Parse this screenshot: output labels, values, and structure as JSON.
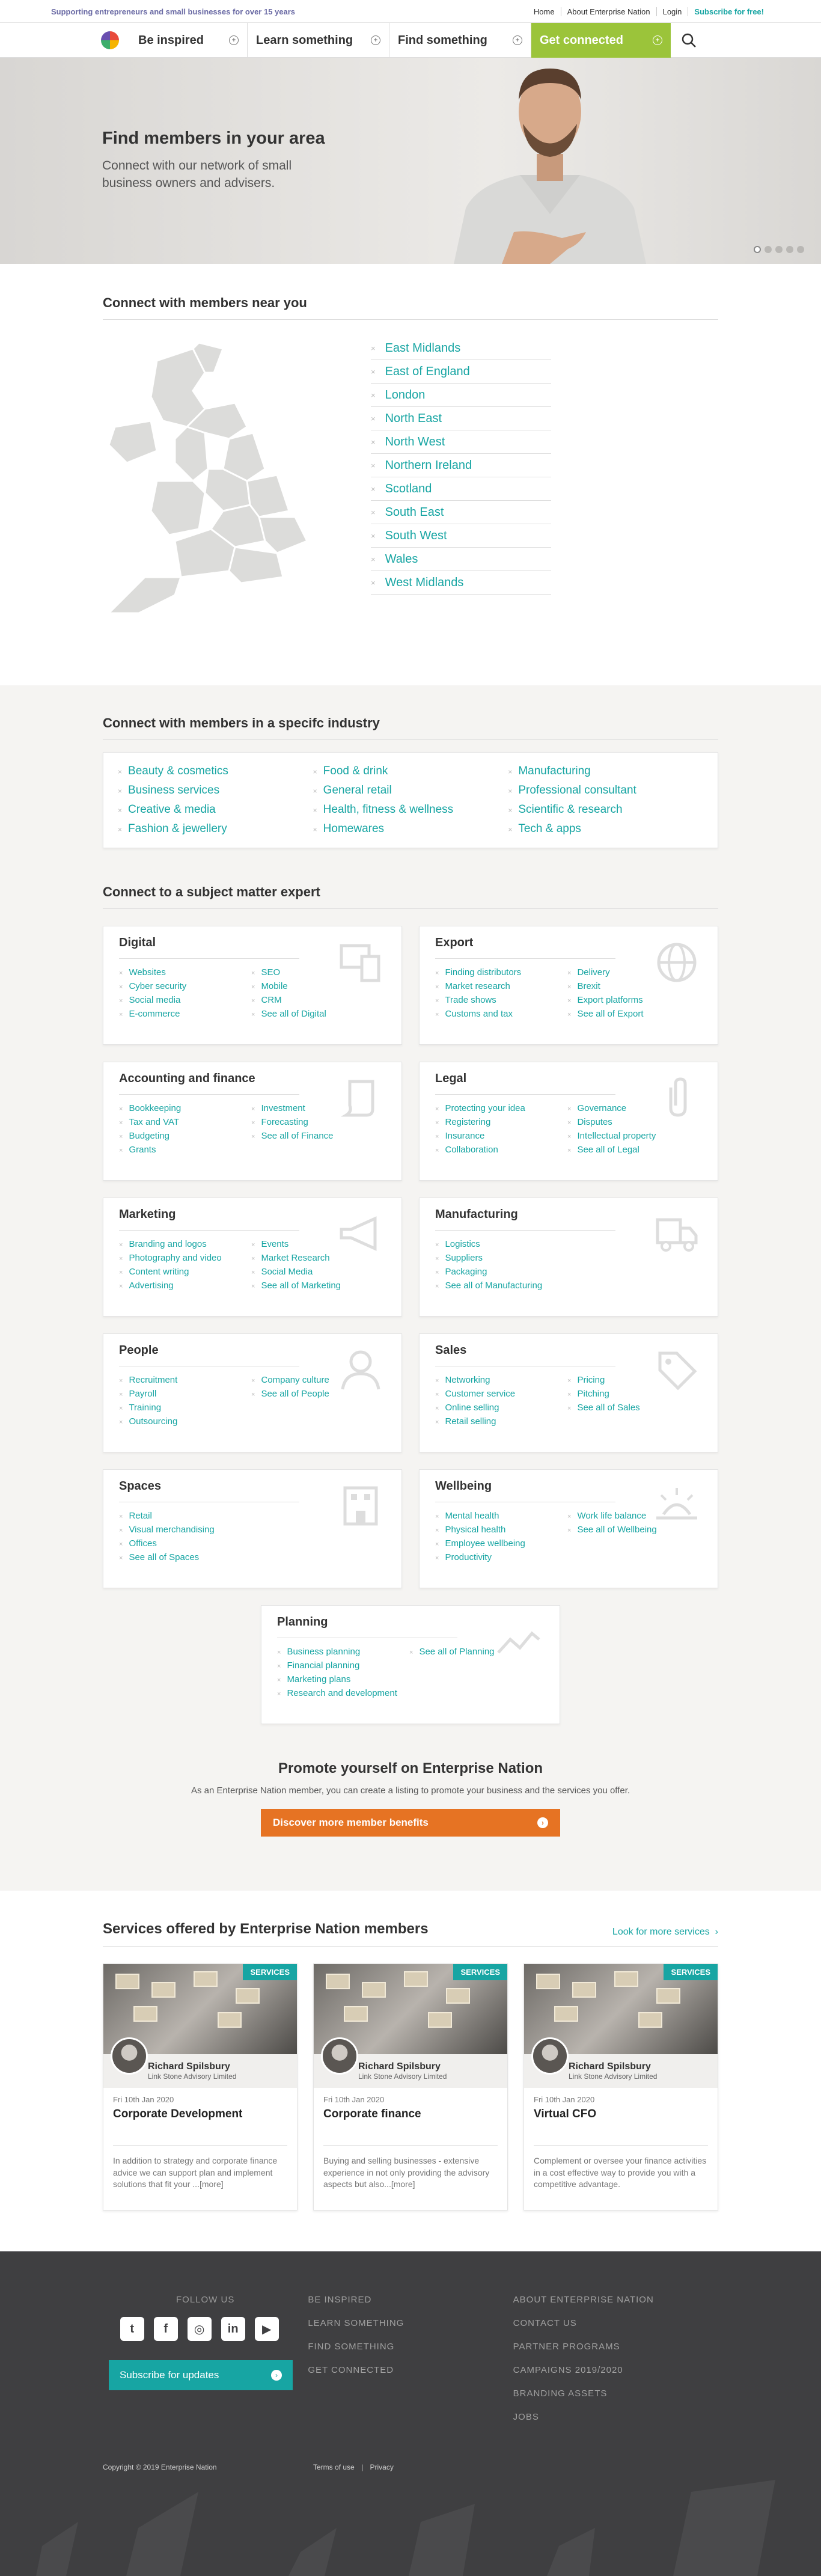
{
  "topbar": {
    "tagline": "Supporting entrepreneurs and small businesses for over 15 years",
    "links": [
      "Home",
      "About Enterprise Nation",
      "Login",
      "Subscribe for free!"
    ]
  },
  "nav": {
    "items": [
      "Be inspired",
      "Learn something",
      "Find something",
      "Get connected"
    ]
  },
  "hero": {
    "title": "Find members in your area",
    "subtitle": "Connect with our network of small business owners and advisers."
  },
  "regions": {
    "title": "Connect with members near you",
    "items": [
      "East Midlands",
      "East of England",
      "London",
      "North East",
      "North West",
      "Northern Ireland",
      "Scotland",
      "South East",
      "South West",
      "Wales",
      "West Midlands"
    ]
  },
  "industry": {
    "title": "Connect with members in a specifc industry",
    "items": [
      "Beauty & cosmetics",
      "Food & drink",
      "Manufacturing",
      "Business services",
      "General retail",
      "Professional consultant",
      "Creative & media",
      "Health, fitness & wellness",
      "Scientific & research",
      "Fashion & jewellery",
      "Homewares",
      "Tech & apps"
    ]
  },
  "experts": {
    "title": "Connect to a subject matter expert",
    "cards": [
      {
        "title": "Digital",
        "icon": "devices-icon",
        "links": [
          "Websites",
          "SEO",
          "Cyber security",
          "Mobile",
          "Social media",
          "CRM",
          "E-commerce",
          "See all of Digital"
        ]
      },
      {
        "title": "Export",
        "icon": "globe-icon",
        "links": [
          "Finding distributors",
          "Delivery",
          "Market research",
          "Brexit",
          "Trade shows",
          "Export platforms",
          "Customs and tax",
          "See all of Export"
        ]
      },
      {
        "title": "Accounting and finance",
        "icon": "scroll-icon",
        "links": [
          "Bookkeeping",
          "Investment",
          "Tax and VAT",
          "Forecasting",
          "Budgeting",
          "See all of Finance",
          "Grants",
          ""
        ]
      },
      {
        "title": "Legal",
        "icon": "paperclip-icon",
        "links": [
          "Protecting your idea",
          "Governance",
          "Registering",
          "Disputes",
          "Insurance",
          "Intellectual property",
          "Collaboration",
          "See all of Legal"
        ]
      },
      {
        "title": "Marketing",
        "icon": "megaphone-icon",
        "links": [
          "Branding and logos",
          "Events",
          "Photography and video",
          "Market Research",
          "Content writing",
          "Social Media",
          "Advertising",
          "See all of Marketing"
        ]
      },
      {
        "title": "Manufacturing",
        "icon": "truck-icon",
        "links": [
          "Logistics",
          "",
          "Suppliers",
          "",
          "Packaging",
          "",
          "See all of Manufacturing",
          ""
        ]
      },
      {
        "title": "People",
        "icon": "person-icon",
        "links": [
          "Recruitment",
          "Company culture",
          "Payroll",
          "See all of People",
          "Training",
          "",
          "Outsourcing",
          ""
        ]
      },
      {
        "title": "Sales",
        "icon": "tag-icon",
        "links": [
          "Networking",
          "Pricing",
          "Customer service",
          "Pitching",
          "Online selling",
          "See all of Sales",
          "Retail selling",
          ""
        ]
      },
      {
        "title": "Spaces",
        "icon": "building-icon",
        "links": [
          "Retail",
          "",
          "Visual merchandising",
          "",
          "Offices",
          "",
          "See all of Spaces",
          ""
        ]
      },
      {
        "title": "Wellbeing",
        "icon": "sunrise-icon",
        "links": [
          "Mental health",
          "Work life balance",
          "Physical health",
          "See all of Wellbeing",
          "Employee wellbeing",
          "",
          "Productivity",
          ""
        ]
      }
    ],
    "planning": {
      "title": "Planning",
      "icon": "chart-line-icon",
      "links": [
        "Business planning",
        "See all of Planning",
        "Financial planning",
        "",
        "Marketing plans",
        "",
        "Research and development",
        ""
      ]
    }
  },
  "promo": {
    "title": "Promote yourself on Enterprise Nation",
    "text": "As an Enterprise Nation member, you can create a listing to promote your business and the services you offer.",
    "button": "Discover more member benefits"
  },
  "services": {
    "title": "Services offered by Enterprise Nation members",
    "more": "Look for more services",
    "cards": [
      {
        "tag": "SERVICES",
        "name": "Richard Spilsbury",
        "company": "Link Stone Advisory Limited",
        "date": "Fri 10th Jan 2020",
        "title": "Corporate Development",
        "desc": "In addition to strategy and corporate finance advice we can support plan and implement solutions that fit your ...[more]"
      },
      {
        "tag": "SERVICES",
        "name": "Richard Spilsbury",
        "company": "Link Stone Advisory Limited",
        "date": "Fri 10th Jan 2020",
        "title": "Corporate finance",
        "desc": "Buying and selling businesses - extensive experience in not only providing the advisory aspects but also...[more]"
      },
      {
        "tag": "SERVICES",
        "name": "Richard Spilsbury",
        "company": "Link Stone Advisory Limited",
        "date": "Fri 10th Jan 2020",
        "title": "Virtual CFO",
        "desc": "Complement or oversee your finance activities in a cost effective way to provide you with a competitive advantage."
      }
    ]
  },
  "footer": {
    "follow": "FOLLOW US",
    "subscribe": "Subscribe for updates",
    "col2": [
      "BE INSPIRED",
      "LEARN SOMETHING",
      "FIND SOMETHING",
      "GET CONNECTED"
    ],
    "col3": [
      "ABOUT ENTERPRISE NATION",
      "CONTACT US",
      "PARTNER PROGRAMS",
      "CAMPAIGNS 2019/2020",
      "BRANDING ASSETS",
      "JOBS"
    ],
    "copyright": "Copyright © 2019 Enterprise Nation",
    "terms": "Terms of use",
    "privacy": "Privacy"
  }
}
